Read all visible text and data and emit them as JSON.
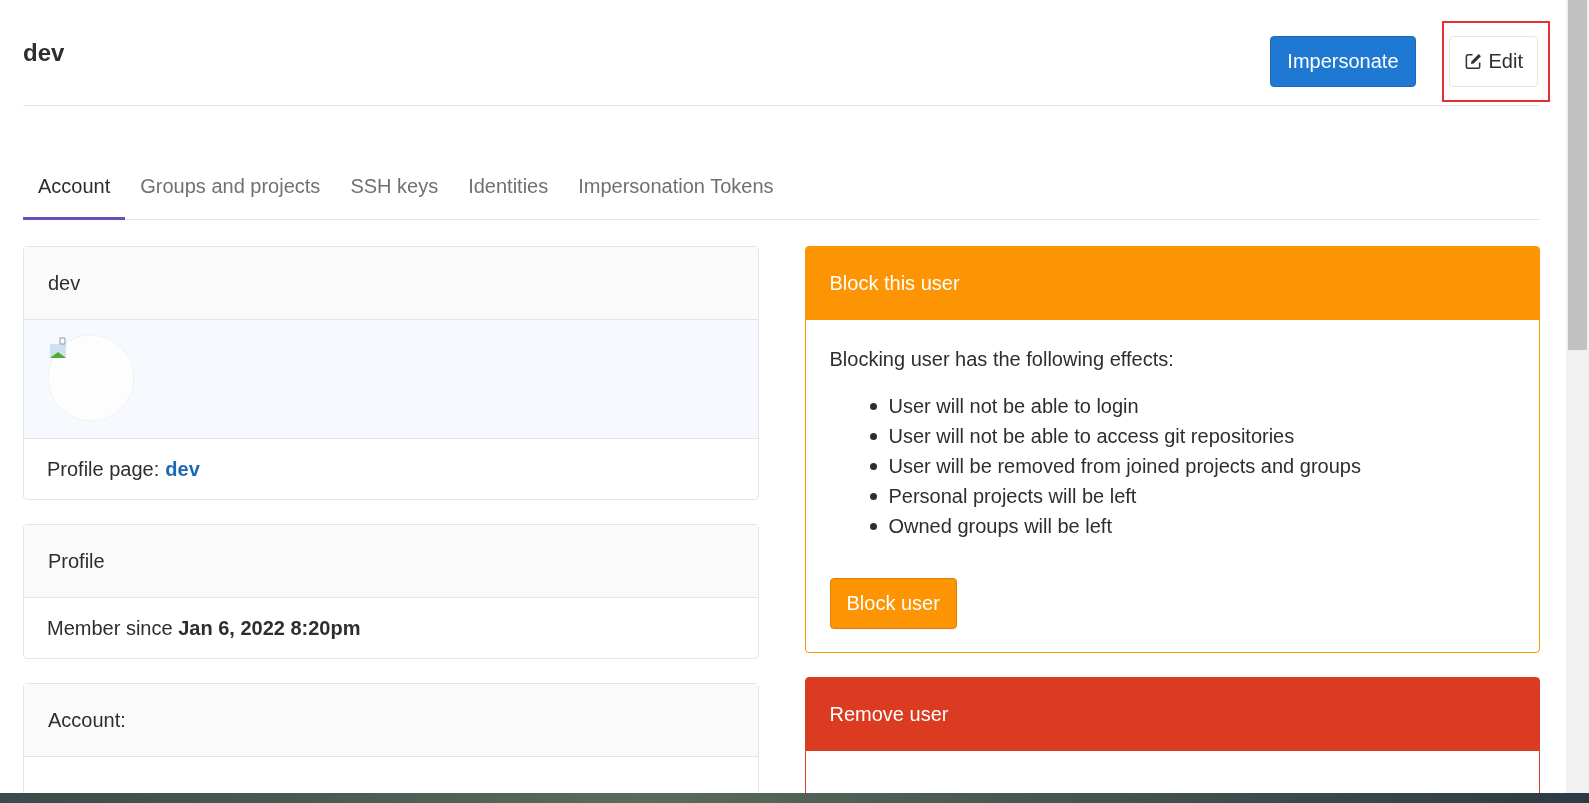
{
  "page_title": "dev",
  "header_buttons": [
    {
      "label": "Impersonate",
      "kind": "primary",
      "highlighted": false
    },
    {
      "label": "Edit",
      "kind": "edit",
      "highlighted": true
    }
  ],
  "tabs": [
    {
      "label": "Account",
      "selected": true
    },
    {
      "label": "Groups and projects",
      "selected": false
    },
    {
      "label": "SSH keys",
      "selected": false
    },
    {
      "label": "Identities",
      "selected": false
    },
    {
      "label": "Impersonation Tokens",
      "selected": false
    }
  ],
  "left_cards": [
    {
      "title": "dev",
      "rows": [
        {
          "kind": "avatar"
        },
        {
          "kind": "link",
          "label": "Profile page: ",
          "link": "dev"
        }
      ]
    },
    {
      "title": "Profile",
      "rows": [
        {
          "kind": "text",
          "text": "Member since **Jan 6, 2022 8:20pm**"
        }
      ]
    },
    {
      "title": "Account:"
    }
  ],
  "right_panels": [
    {
      "kind": "warning",
      "title": "Block this user",
      "intro": "Blocking user has the following effects:",
      "effects": [
        "User will not be able to login",
        "User will not be able to access git repositories",
        "User will be removed from joined projects and groups",
        "Personal projects will be left",
        "Owned groups will be left"
      ],
      "button": "Block user"
    },
    {
      "kind": "danger",
      "title": "Remove user"
    }
  ]
}
